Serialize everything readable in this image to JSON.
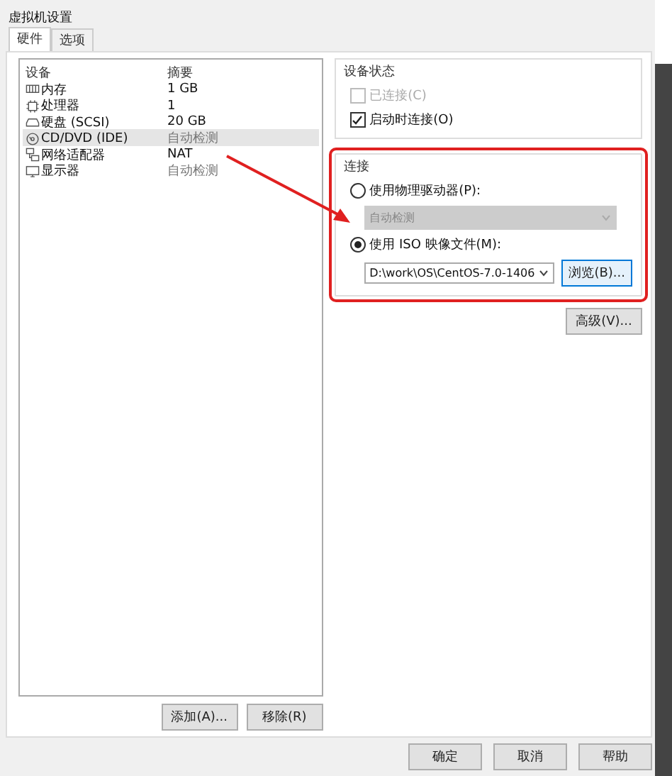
{
  "window": {
    "title": "虚拟机设置"
  },
  "tabs": [
    {
      "label": "硬件",
      "selected": true
    },
    {
      "label": "选项",
      "selected": false
    }
  ],
  "devices": {
    "columns": [
      "设备",
      "摘要"
    ],
    "rows": [
      {
        "kind": "memory",
        "name": "内存",
        "summary": "1 GB",
        "selected": false
      },
      {
        "kind": "cpu",
        "name": "处理器",
        "summary": "1",
        "selected": false
      },
      {
        "kind": "disk",
        "name": "硬盘 (SCSI)",
        "summary": "20 GB",
        "selected": false
      },
      {
        "kind": "cd",
        "name": "CD/DVD (IDE)",
        "summary": "自动检测",
        "selected": true
      },
      {
        "kind": "network",
        "name": "网络适配器",
        "summary": "NAT",
        "selected": false
      },
      {
        "kind": "monitor",
        "name": "显示器",
        "summary": "自动检测",
        "selected": false
      }
    ],
    "buttons": [
      "添加(A)...",
      "移除(R)"
    ]
  },
  "device_status": {
    "title": "设备状态",
    "options": [
      {
        "label": "已连接(C)",
        "checked": false,
        "disabled": true
      },
      {
        "label": "启动时连接(O)",
        "checked": true,
        "disabled": false
      }
    ]
  },
  "connection": {
    "title": "连接",
    "options": [
      {
        "label": "使用物理驱动器(P):",
        "selected": false,
        "dropdown": {
          "value": "自动检测",
          "disabled": true
        }
      },
      {
        "label": "使用 ISO 映像文件(M):",
        "selected": true,
        "dropdown": {
          "value": "D:\\work\\OS\\CentOS-7.0-1406",
          "disabled": false
        }
      }
    ],
    "browse_button": "浏览(B)..."
  },
  "advanced_button": "高级(V)...",
  "footer_buttons": [
    "确定",
    "取消",
    "帮助"
  ]
}
